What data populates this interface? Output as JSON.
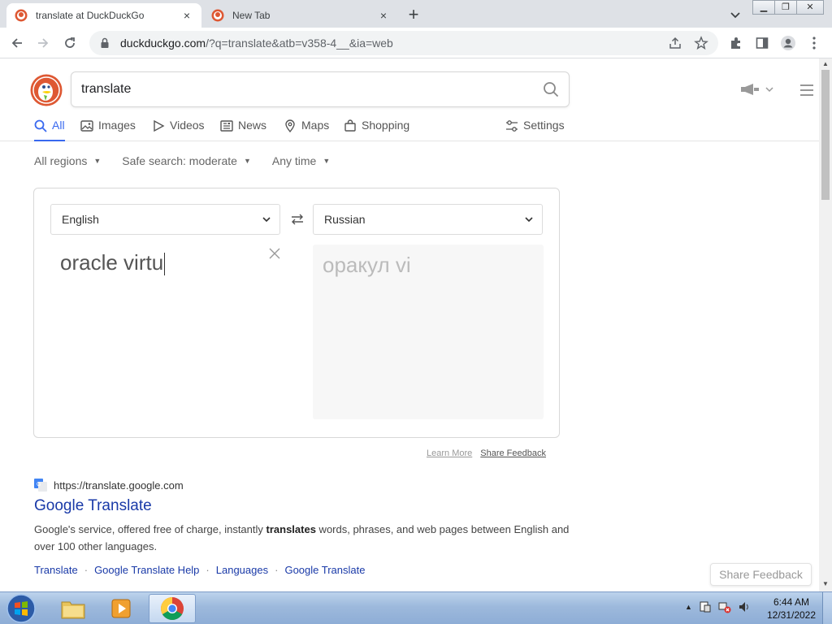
{
  "browser": {
    "tabs": [
      {
        "title": "translate at DuckDuckGo",
        "active": true
      },
      {
        "title": "New Tab",
        "active": false
      }
    ],
    "new_tab_symbol": "+",
    "close_symbol": "×",
    "url_host": "duckduckgo.com",
    "url_rest": "/?q=translate&atb=v358-4__&ia=web"
  },
  "search": {
    "query": "translate"
  },
  "nav_tabs": {
    "all": "All",
    "images": "Images",
    "videos": "Videos",
    "news": "News",
    "maps": "Maps",
    "shopping": "Shopping",
    "settings": "Settings"
  },
  "filters": {
    "regions": "All regions",
    "safe_search": "Safe search: moderate",
    "time": "Any time"
  },
  "translator": {
    "source_language": "English",
    "target_language": "Russian",
    "source_text": "oracle virtu",
    "output_text": "оракул vi",
    "learn_more": "Learn More",
    "share_feedback": "Share Feedback"
  },
  "result": {
    "url": "https://translate.google.com",
    "title": "Google Translate",
    "snippet_before": "Google's service, offered free of charge, instantly ",
    "snippet_bold": "translates",
    "snippet_after": " words, phrases, and web pages between English and over 100 other languages.",
    "sitelinks": [
      "Translate",
      "Google Translate Help",
      "Languages",
      "Google Translate"
    ]
  },
  "share_feedback_button": "Share Feedback",
  "taskbar": {
    "time": "6:44 AM",
    "date": "12/31/2022"
  },
  "colors": {
    "accent": "#3969ef",
    "link": "#1a3aa8",
    "ddg_orange": "#de5833"
  }
}
